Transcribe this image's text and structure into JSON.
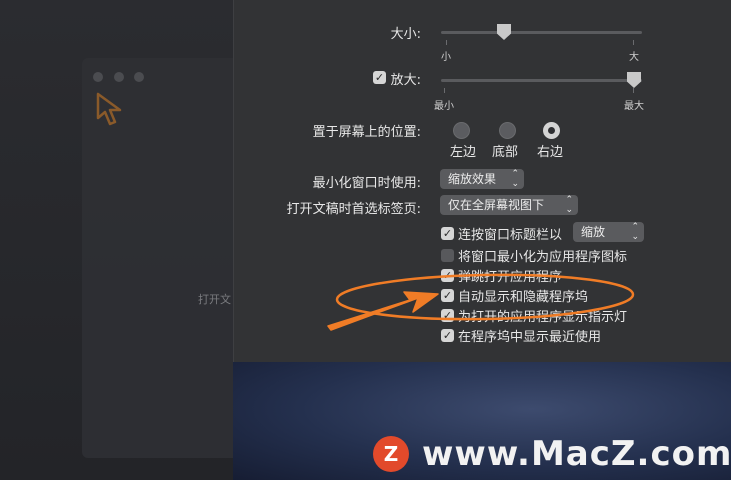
{
  "background": {
    "partial_text_1": "打开文"
  },
  "size": {
    "label": "大小:",
    "min_label": "小",
    "max_label": "大",
    "value": 0.32
  },
  "magnification": {
    "label": "放大:",
    "checked": true,
    "min_label": "最小",
    "max_label": "最大",
    "value": 1.0
  },
  "position": {
    "label": "置于屏幕上的位置:",
    "options": [
      "左边",
      "底部",
      "右边"
    ],
    "selected": "右边"
  },
  "minimize_using": {
    "label": "最小化窗口时使用:",
    "value": "缩放效果"
  },
  "prefer_tabs": {
    "label": "打开文稿时首选标签页:",
    "value": "仅在全屏幕视图下"
  },
  "checkboxes": {
    "double_click": {
      "label": "连按窗口标题栏以",
      "checked": true,
      "popup": "缩放"
    },
    "minimize_into_icon": {
      "label": "将窗口最小化为应用程序图标",
      "checked": false
    },
    "animate": {
      "label": "弹跳打开应用程序",
      "checked": true
    },
    "autohide": {
      "label": "自动显示和隐藏程序坞",
      "checked": true
    },
    "indicators": {
      "label": "为打开的应用程序显示指示灯",
      "checked": true
    },
    "recent": {
      "label": "在程序坞中显示最近使用",
      "checked": true
    }
  },
  "watermark": {
    "logo_letter": "Z",
    "text": "www.MacZ.com"
  },
  "colors": {
    "panel_bg": "#323335",
    "annotation_orange": "#f07c26",
    "watermark_logo": "#e24a2b"
  }
}
